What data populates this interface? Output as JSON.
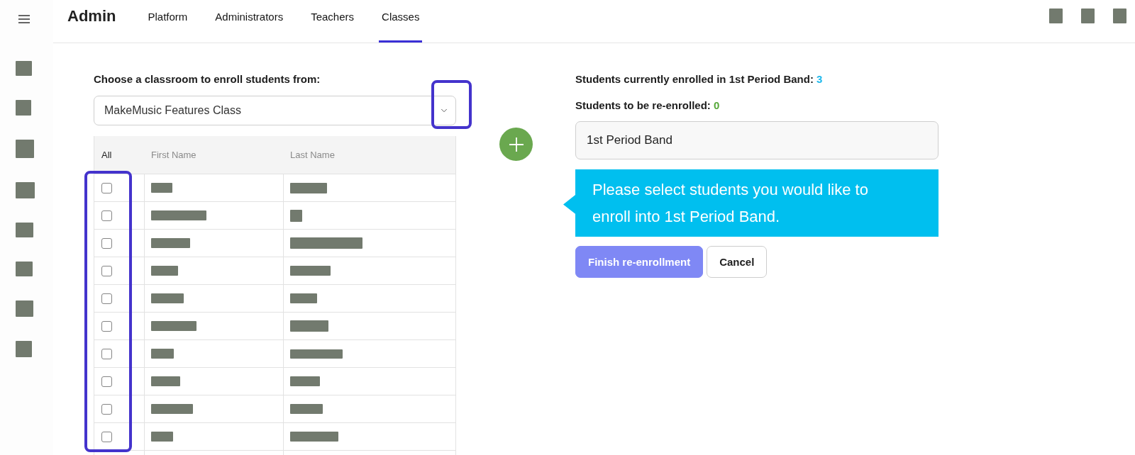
{
  "app": {
    "title": "Admin"
  },
  "nav": {
    "tabs": [
      {
        "label": "Platform",
        "selected": false
      },
      {
        "label": "Administrators",
        "selected": false
      },
      {
        "label": "Teachers",
        "selected": false
      },
      {
        "label": "Classes",
        "selected": true
      }
    ]
  },
  "classroom_select": {
    "label": "Choose a classroom to enroll students from:",
    "value": "MakeMusic Features Class"
  },
  "table": {
    "columns": [
      {
        "label": "All",
        "kind": "select_all"
      },
      {
        "label": "First Name",
        "kind": "text"
      },
      {
        "label": "Last Name",
        "kind": "text"
      }
    ],
    "rows": [
      {
        "checked": false
      },
      {
        "checked": false
      },
      {
        "checked": false
      },
      {
        "checked": false
      },
      {
        "checked": false
      },
      {
        "checked": false
      },
      {
        "checked": false
      },
      {
        "checked": false
      },
      {
        "checked": false
      },
      {
        "checked": false
      }
    ]
  },
  "enrollment": {
    "current_label": "Students currently enrolled in 1st Period Band:",
    "current_count": "3",
    "pending_label": "Students to be re-enrolled:",
    "pending_count": "0"
  },
  "class_name_field": {
    "value": "1st Period Band"
  },
  "callout": {
    "text": "Please select students you would like to enroll into 1st Period Band."
  },
  "buttons": [
    {
      "label": "Finish re-enrollment",
      "kind": "primary"
    },
    {
      "label": "Cancel",
      "kind": "secondary"
    }
  ]
}
